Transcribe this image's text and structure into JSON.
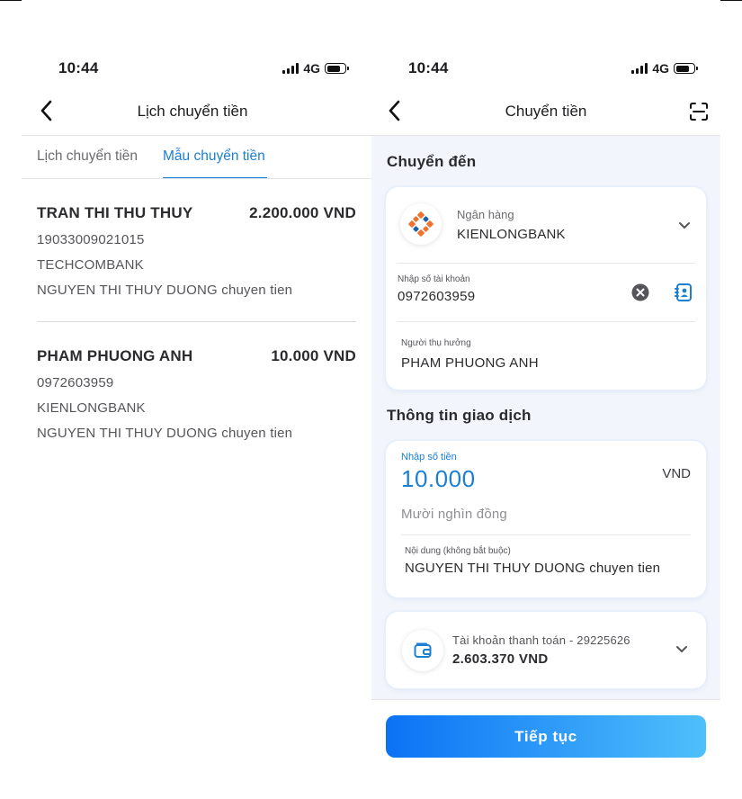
{
  "status_bar": {
    "time": "10:44",
    "network": "4G"
  },
  "left": {
    "title": "Lịch chuyển tiền",
    "tabs": [
      {
        "label": "Lịch chuyển tiền",
        "active": false
      },
      {
        "label": "Mẫu chuyển tiền",
        "active": true
      }
    ],
    "entries": [
      {
        "name": "TRAN THI THU THUY",
        "amount": "2.200.000 VND",
        "account": "19033009021015",
        "bank": "TECHCOMBANK",
        "memo": "NGUYEN THI THUY DUONG chuyen tien"
      },
      {
        "name": "PHAM PHUONG ANH",
        "amount": "10.000 VND",
        "account": "0972603959",
        "bank": "KIENLONGBANK",
        "memo": "NGUYEN THI THUY DUONG chuyen tien"
      }
    ]
  },
  "right": {
    "title": "Chuyển tiền",
    "section_to": "Chuyển đến",
    "bank": {
      "label": "Ngân hàng",
      "name": "KIENLONGBANK"
    },
    "account": {
      "label": "Nhập số tài khoản",
      "value": "0972603959"
    },
    "beneficiary": {
      "label": "Người thụ hưởng",
      "value": "PHAM PHUONG ANH"
    },
    "section_tx": "Thông tin giao dịch",
    "amount": {
      "label": "Nhập số tiền",
      "value": "10.000",
      "unit": "VND",
      "words": "Mười nghìn đồng"
    },
    "memo": {
      "label": "Nội dung (không bắt buộc)",
      "value": "NGUYEN THI THUY DUONG chuyen tien"
    },
    "payment_account": {
      "label": "Tài khoản thanh toán - 29225626",
      "balance": "2.603.370 VND"
    },
    "continue_label": "Tiếp tục"
  },
  "colors": {
    "accent": "#1b7fd4",
    "button_start": "#0b72f5",
    "button_end": "#4fc0fb",
    "logo_orange": "#f0712b"
  }
}
